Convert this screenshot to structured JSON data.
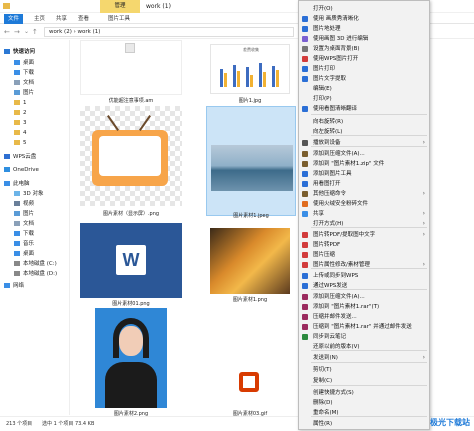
{
  "window": {
    "title": "work (1)",
    "manage_tab": "管理",
    "tool_tab": "图片工具"
  },
  "ribbon": {
    "tabs": [
      "文件",
      "主页",
      "共享",
      "查看"
    ]
  },
  "address": {
    "path": "work (2) › work (1)"
  },
  "sidebar": {
    "quick_access": "快速访问",
    "items": [
      "桌面",
      "下载",
      "文档",
      "图片",
      "1",
      "2",
      "3",
      "4",
      "5"
    ],
    "wps": "WPS云盘",
    "onedrive": "OneDrive",
    "pc": "此电脑",
    "pc_items": [
      "3D 对象",
      "视频",
      "图片",
      "文档",
      "下载",
      "音乐",
      "桌面",
      "本地磁盘 (C:)",
      "本地磁盘 (D:)"
    ],
    "network": "网络"
  },
  "files": [
    {
      "name": "优能超注意事项.am"
    },
    {
      "name": "图片1.jpg"
    },
    {
      "name": "图片素材（显示屏）.png"
    },
    {
      "name": "图片素材1.jpeg"
    },
    {
      "name": "图片素材01.png"
    },
    {
      "name": "图片素材1.png"
    },
    {
      "name": "图片素材2.png"
    },
    {
      "name": "图片素材03.gif"
    }
  ],
  "chart_thumb": {
    "title": "差费收集"
  },
  "status": {
    "count": "213 个项目",
    "selected": "选中 1 个项目  73.4 KB"
  },
  "menu": {
    "items": [
      "打开(O)",
      "使用 画质秀清晰化",
      "图片地处理",
      "使用画图 3D 进行编辑",
      "设置为桌面背景(B)",
      "使用WPS图片打开",
      "图片打印",
      "图片文字提取",
      "编辑(E)",
      "打印(P)",
      "使用看图清晰翻译",
      "向右旋转(R)",
      "向左旋转(L)",
      "播放到设备",
      "添加到压缩文件(A)...",
      "添加到 \"图片素材1.zip\" 文件",
      "添加到图片工具",
      "用看图打开",
      "其他压缩命令",
      "使用火绒安全粉碎文件",
      "共享",
      "打开方式(H)",
      "图片转PDF/提取图中文字",
      "图片转PDF",
      "图片压缩",
      "图片属性修改/素材管理",
      "上传或同步到WPS",
      "通过WPS发送",
      "添加到压缩文件(A)...",
      "添加到 \"图片素材1.rar\"(T)",
      "压缩并邮件发送...",
      "压缩到 \"图片素材1.rar\" 并通过邮件发送",
      "同步到云笔记",
      "还原以前的版本(V)",
      "发送到(N)",
      "剪切(T)",
      "复制(C)",
      "创建快捷方式(S)",
      "删除(D)",
      "重命名(M)",
      "属性(R)"
    ]
  },
  "watermark": "极光下载站",
  "colors": {
    "accent": "#1e7ad8",
    "manage": "#f5d76e"
  }
}
